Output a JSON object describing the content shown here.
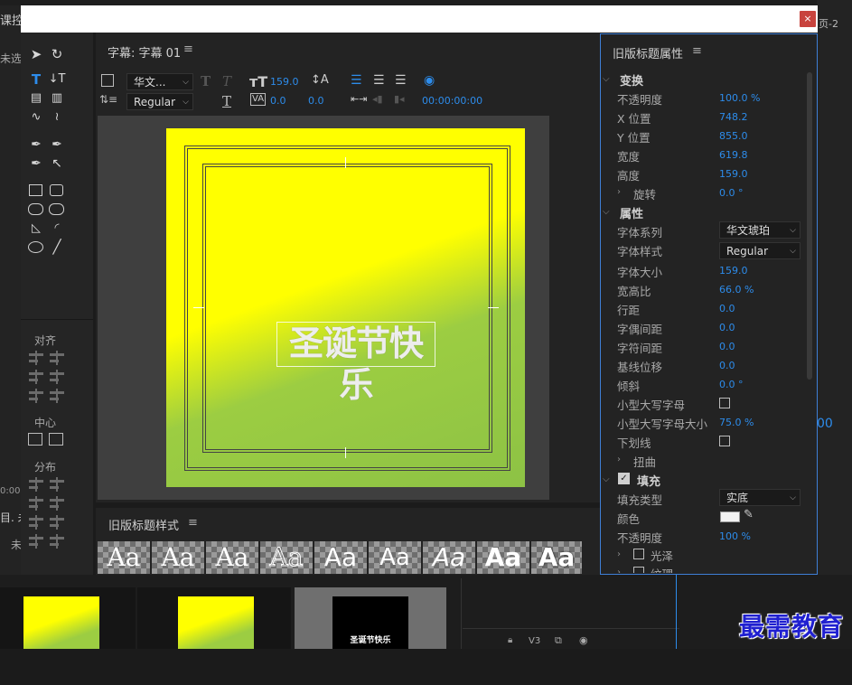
{
  "background": {
    "left_texts": [
      "课控",
      "未选",
      "0:00:0",
      "目. 未",
      "未"
    ],
    "right_texts": [
      "页-2",
      "00"
    ],
    "timeline": {
      "track_label": "V3",
      "title_thumbnail_text": "圣诞节快乐"
    }
  },
  "dialog": {
    "close_label": "×"
  },
  "tools": {
    "align_label": "对齐",
    "center_label": "中心",
    "distribute_label": "分布"
  },
  "main": {
    "panel_title": "字幕: 字幕 01",
    "font_family": "华文...",
    "font_style": "Regular",
    "font_size": "159.0",
    "kerning": "0.0",
    "tracking": "0.0",
    "timecode": "00:00:00:00",
    "title_text": "圣诞节快乐"
  },
  "styles": {
    "panel_title": "旧版标题样式",
    "swatch_label": "Aa",
    "swatch_count": 9
  },
  "props": {
    "panel_title": "旧版标题属性",
    "transform": {
      "header": "变换",
      "opacity_label": "不透明度",
      "opacity": "100.0 %",
      "x_label": "X 位置",
      "x": "748.2",
      "y_label": "Y 位置",
      "y": "855.0",
      "width_label": "宽度",
      "width": "619.8",
      "height_label": "高度",
      "height": "159.0",
      "rotation_label": "旋转",
      "rotation": "0.0 °"
    },
    "properties": {
      "header": "属性",
      "font_family_label": "字体系列",
      "font_family": "华文琥珀",
      "font_style_label": "字体样式",
      "font_style": "Regular",
      "font_size_label": "字体大小",
      "font_size": "159.0",
      "aspect_label": "宽高比",
      "aspect": "66.0 %",
      "leading_label": "行距",
      "leading": "0.0",
      "kerning_label": "字偶间距",
      "kerning": "0.0",
      "tracking_label": "字符间距",
      "tracking": "0.0",
      "baseline_label": "基线位移",
      "baseline": "0.0",
      "slant_label": "倾斜",
      "slant": "0.0 °",
      "small_caps_label": "小型大写字母",
      "small_caps_size_label": "小型大写字母大小",
      "small_caps_size": "75.0 %",
      "underline_label": "下划线",
      "distort_label": "扭曲"
    },
    "fill": {
      "header": "填充",
      "fill_type_label": "填充类型",
      "fill_type": "实底",
      "color_label": "颜色",
      "color_value": "#f2f2f2",
      "opacity_label": "不透明度",
      "opacity": "100 %",
      "sheen_label": "光泽",
      "texture_label": "纹理"
    }
  },
  "watermark": "最需教育",
  "colors": {
    "accent": "#2d8ceb",
    "close": "#c8433d",
    "yellow": "#ffff00",
    "green": "#8dc245"
  }
}
